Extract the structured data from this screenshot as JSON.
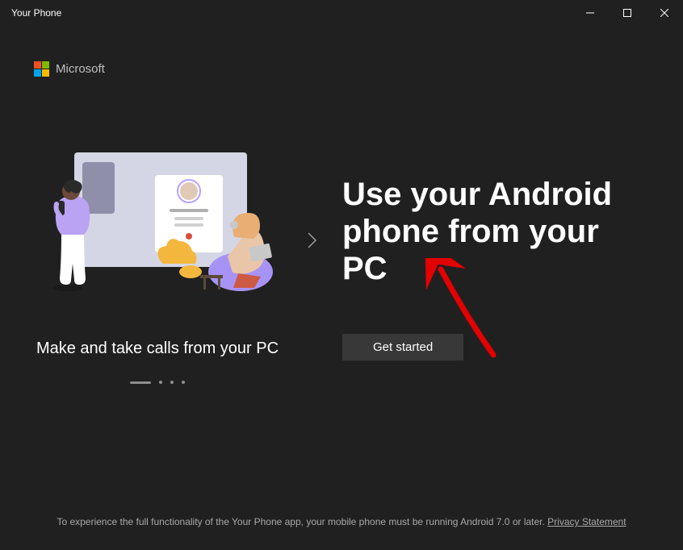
{
  "window": {
    "title": "Your Phone"
  },
  "brand": {
    "name": "Microsoft"
  },
  "carousel": {
    "caption": "Make and take calls from your PC",
    "activeIndex": 0,
    "totalSlides": 4
  },
  "hero": {
    "title": "Use your Android phone from your PC",
    "cta": "Get started"
  },
  "footer": {
    "text": "To experience the full functionality of the Your Phone app, your mobile phone must be running Android 7.0 or later. ",
    "linkLabel": "Privacy Statement"
  }
}
